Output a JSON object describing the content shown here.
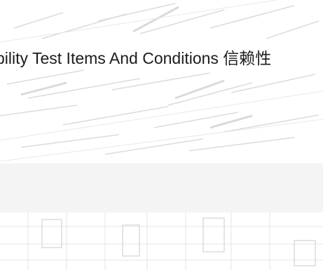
{
  "banner": {
    "title": "bility Test Items And Conditions  信赖性"
  },
  "colors": {
    "background": "#ffffff",
    "streak": "#d9dde0",
    "band": "#f4f4f4",
    "text": "#1c1c1c"
  }
}
